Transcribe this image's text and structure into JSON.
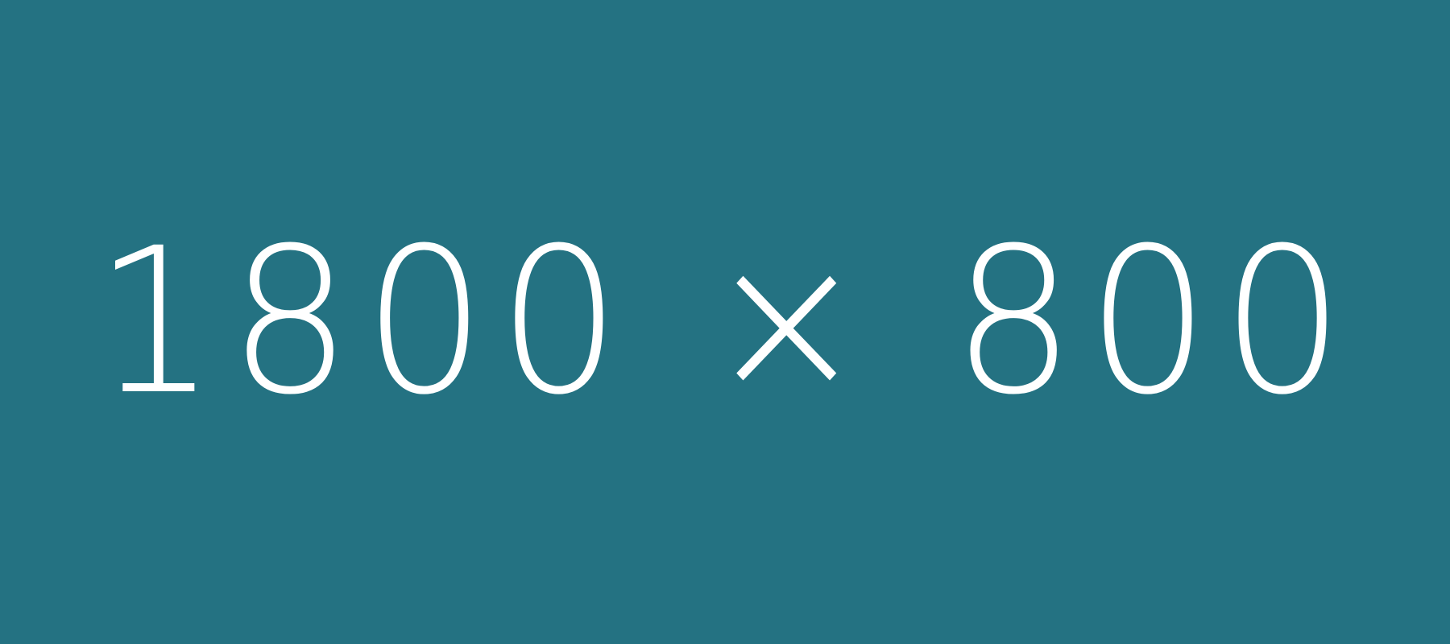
{
  "placeholder": {
    "text": "1800 × 800",
    "background_color": "#247282",
    "text_color": "#ffffff"
  }
}
